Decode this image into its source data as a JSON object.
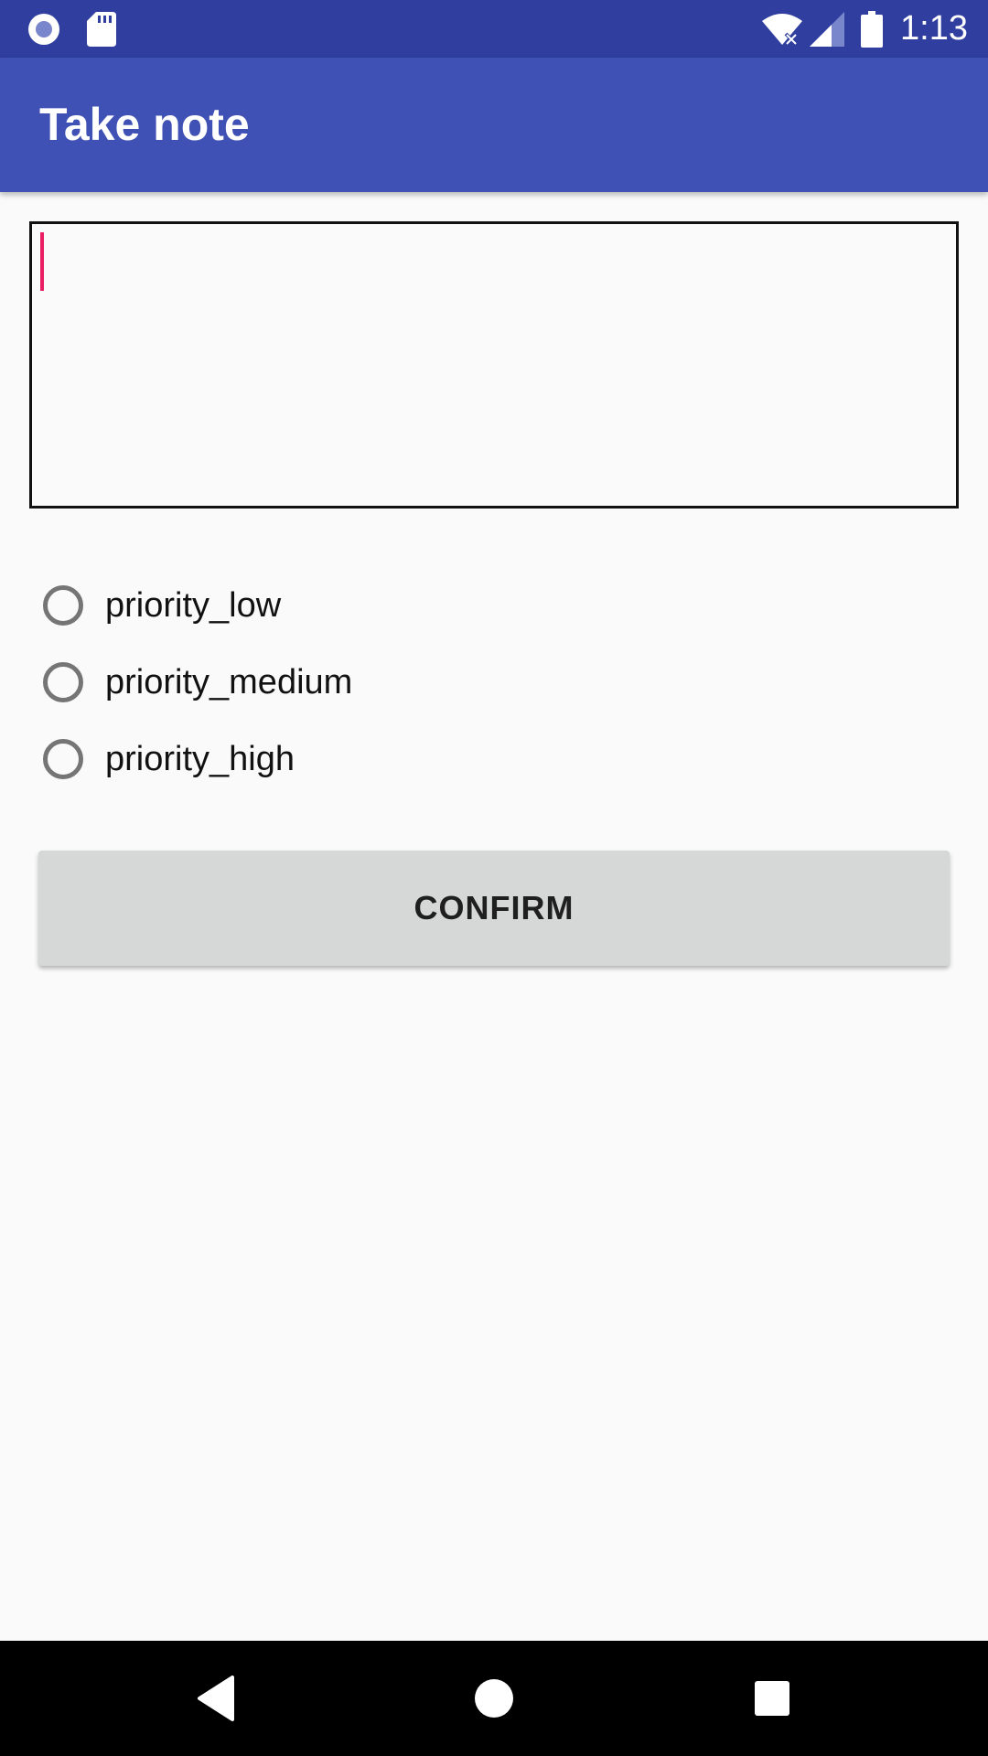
{
  "status_bar": {
    "time": "1:13",
    "icons": [
      "radio-indicator-icon",
      "sd-card-icon",
      "wifi-icon",
      "cell-signal-icon",
      "battery-icon"
    ],
    "color": "#303f9f"
  },
  "app_bar": {
    "title": "Take note",
    "color": "#3f51b5"
  },
  "note_input": {
    "value": "",
    "placeholder": "",
    "cursor_color": "#e91e63"
  },
  "priority_options": [
    {
      "label": "priority_low",
      "selected": false
    },
    {
      "label": "priority_medium",
      "selected": false
    },
    {
      "label": "priority_high",
      "selected": false
    }
  ],
  "confirm_button": {
    "label": "CONFIRM"
  },
  "nav_bar": {
    "icons": [
      "back-icon",
      "home-icon",
      "recents-icon"
    ]
  }
}
